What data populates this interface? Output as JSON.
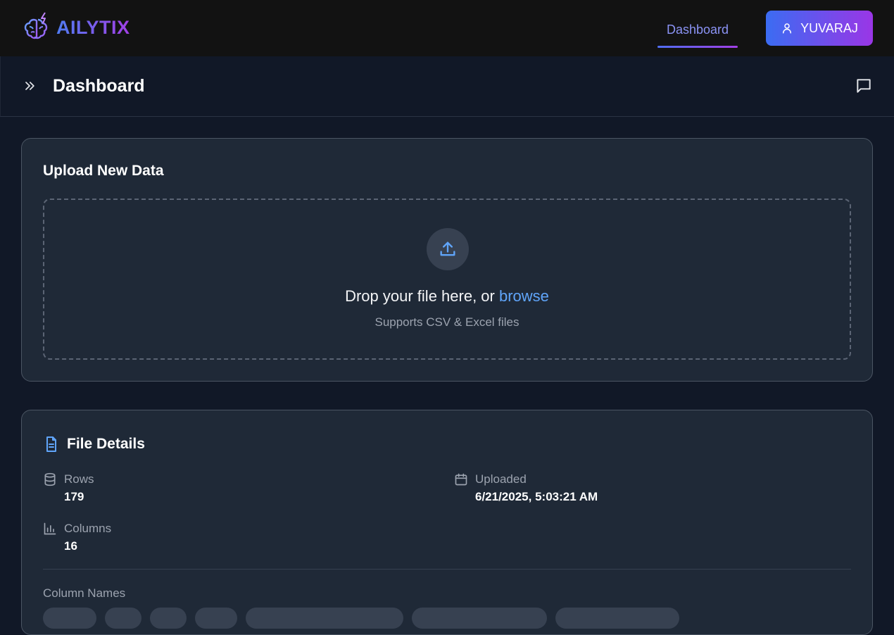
{
  "brand": {
    "name": "AILYTIX",
    "logo_icon": "brain-icon"
  },
  "nav": {
    "dashboard_link": "Dashboard"
  },
  "user": {
    "name": "YUVARAJ",
    "icon": "user-icon"
  },
  "subheader": {
    "title": "Dashboard",
    "expand_icon": "chevrons-right-icon",
    "chat_icon": "message-square-icon"
  },
  "upload": {
    "title": "Upload New Data",
    "drop_text": "Drop your file here, or",
    "browse_label": "browse",
    "supports_text": "Supports CSV & Excel files",
    "icon": "upload-icon"
  },
  "file_details": {
    "title": "File Details",
    "rows_label": "Rows",
    "rows_value": "179",
    "columns_label": "Columns",
    "columns_value": "16",
    "uploaded_label": "Uploaded",
    "uploaded_value": "6/21/2025, 5:03:21 AM",
    "column_names_label": "Column Names"
  },
  "colors": {
    "accent_start": "#3b6cf2",
    "accent_end": "#9a36e6",
    "link": "#60a5fa"
  }
}
